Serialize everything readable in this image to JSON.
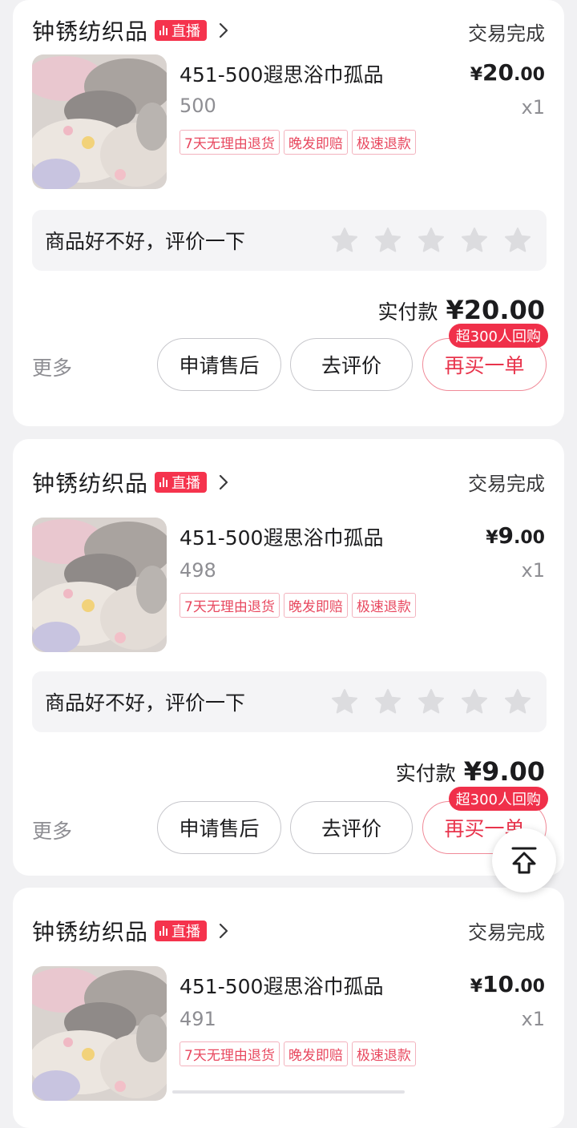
{
  "orders": [
    {
      "store": "钟锈纺织品",
      "live_badge": "直播",
      "status": "交易完成",
      "title": "451-500遐思浴巾孤品",
      "sku": "500",
      "price_currency": "¥",
      "price_int": "20",
      "price_dec": ".00",
      "qty": "x1",
      "tags": [
        "7天无理由退货",
        "晚发即赔",
        "极速退款"
      ],
      "rate_prompt": "商品好不好，评价一下",
      "paid_label": "实付款",
      "paid_amount": "¥20.00",
      "more": "更多",
      "btn_after": "申请售后",
      "btn_review": "去评价",
      "btn_rebuy": "再买一单",
      "repurchase_badge": "超300人回购"
    },
    {
      "store": "钟锈纺织品",
      "live_badge": "直播",
      "status": "交易完成",
      "title": "451-500遐思浴巾孤品",
      "sku": "498",
      "price_currency": "¥",
      "price_int": "9",
      "price_dec": ".00",
      "qty": "x1",
      "tags": [
        "7天无理由退货",
        "晚发即赔",
        "极速退款"
      ],
      "rate_prompt": "商品好不好，评价一下",
      "paid_label": "实付款",
      "paid_amount": "¥9.00",
      "more": "更多",
      "btn_after": "申请售后",
      "btn_review": "去评价",
      "btn_rebuy": "再买一单",
      "repurchase_badge": "超300人回购"
    },
    {
      "store": "钟锈纺织品",
      "live_badge": "直播",
      "status": "交易完成",
      "title": "451-500遐思浴巾孤品",
      "sku": "491",
      "price_currency": "¥",
      "price_int": "10",
      "price_dec": ".00",
      "qty": "x1",
      "tags": [
        "7天无理由退货",
        "晚发即赔",
        "极速退款"
      ]
    }
  ],
  "icons": {
    "live": "live-bars-icon",
    "chevron": "chevron-right-icon",
    "star": "star-icon",
    "back_to_top": "back-to-top-icon"
  },
  "colors": {
    "accent_red": "#f0304a",
    "tag_red": "#e8485f",
    "star_gray": "#dcdcdf"
  }
}
